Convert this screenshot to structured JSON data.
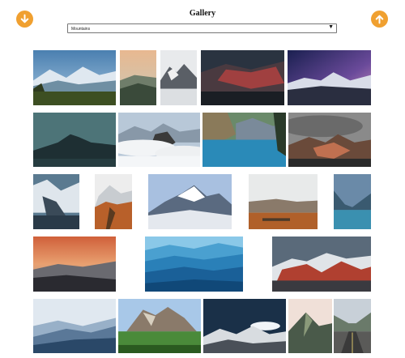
{
  "header": {
    "title": "Gallery",
    "left_icon": "arrow-down-circle-icon",
    "right_icon": "arrow-up-circle-icon",
    "accent_color": "#f0a030"
  },
  "category_select": {
    "selected": "Mountains",
    "arrow_glyph": "▼"
  }
}
